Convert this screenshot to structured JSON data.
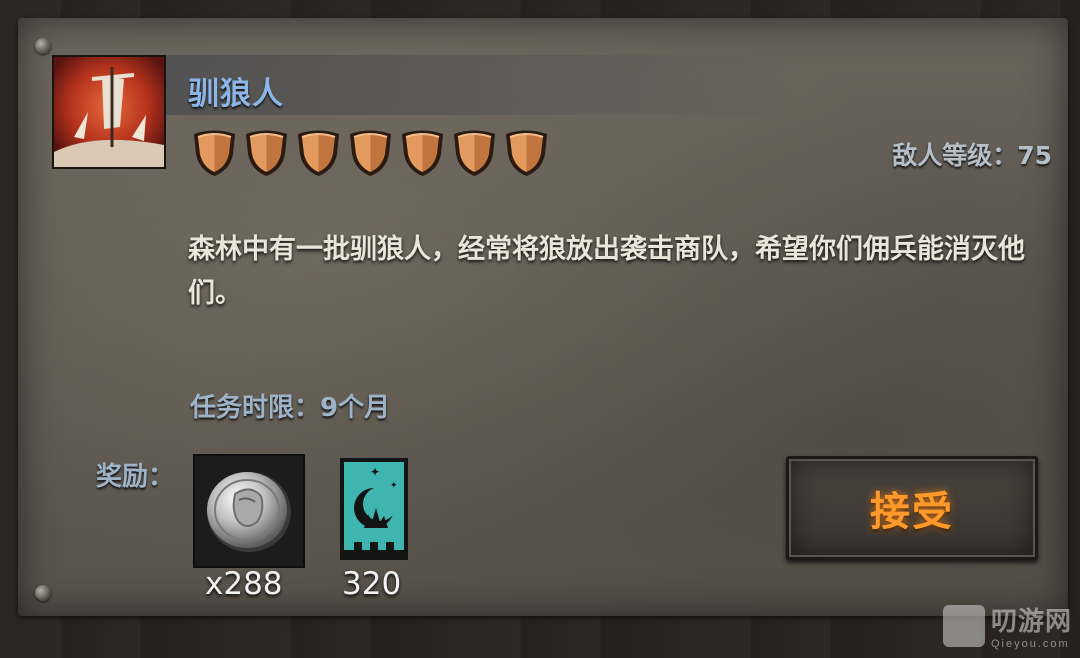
{
  "quest": {
    "title": "驯狼人",
    "difficulty_shields": 7,
    "enemy_level": "敌人等级：75",
    "description": "森林中有一批驯狼人，经常将狼放出袭击商队，希望你们佣兵能消灭他们。",
    "time_limit": "任务时限：9个月"
  },
  "rewards": {
    "label": "奖励：",
    "items": [
      {
        "icon": "silver-coin-icon",
        "count": "x288"
      },
      {
        "icon": "moon-banner-icon",
        "count": "320"
      }
    ]
  },
  "accept_button": {
    "label": "接受"
  },
  "watermark": {
    "cn": "叨游网",
    "en": "Qieyou.com"
  },
  "colors": {
    "title": "#8cb6e8",
    "accept": "#ff9a2a",
    "banner": "#3fb5b0"
  }
}
